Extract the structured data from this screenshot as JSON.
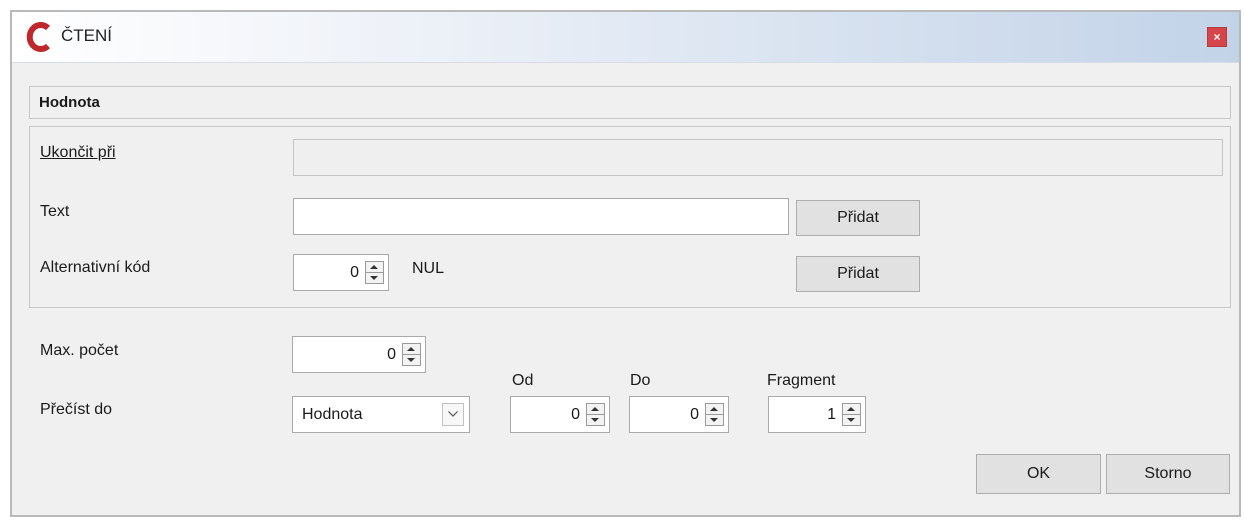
{
  "window": {
    "title": "ČTENÍ",
    "close_label": "×"
  },
  "header": {
    "title": "Hodnota"
  },
  "group": {
    "ukoncit_label": "Ukončit při",
    "text_label": "Text",
    "text_value": "",
    "text_add_button": "Přidat",
    "alt_code_label": "Alternativní kód",
    "alt_code_value": "0",
    "alt_code_name": "NUL",
    "alt_add_button": "Přidat"
  },
  "options": {
    "max_count_label": "Max. počet",
    "max_count_value": "0",
    "read_to_label": "Přečíst do",
    "read_to_value": "Hodnota",
    "from_label": "Od",
    "from_value": "0",
    "to_label": "Do",
    "to_value": "0",
    "fragment_label": "Fragment",
    "fragment_value": "1"
  },
  "footer": {
    "ok_label": "OK",
    "cancel_label": "Storno"
  },
  "colors": {
    "logo": "#c0272d",
    "close_bg": "#d6454a",
    "titlebar_end": "#c2d3e8"
  }
}
